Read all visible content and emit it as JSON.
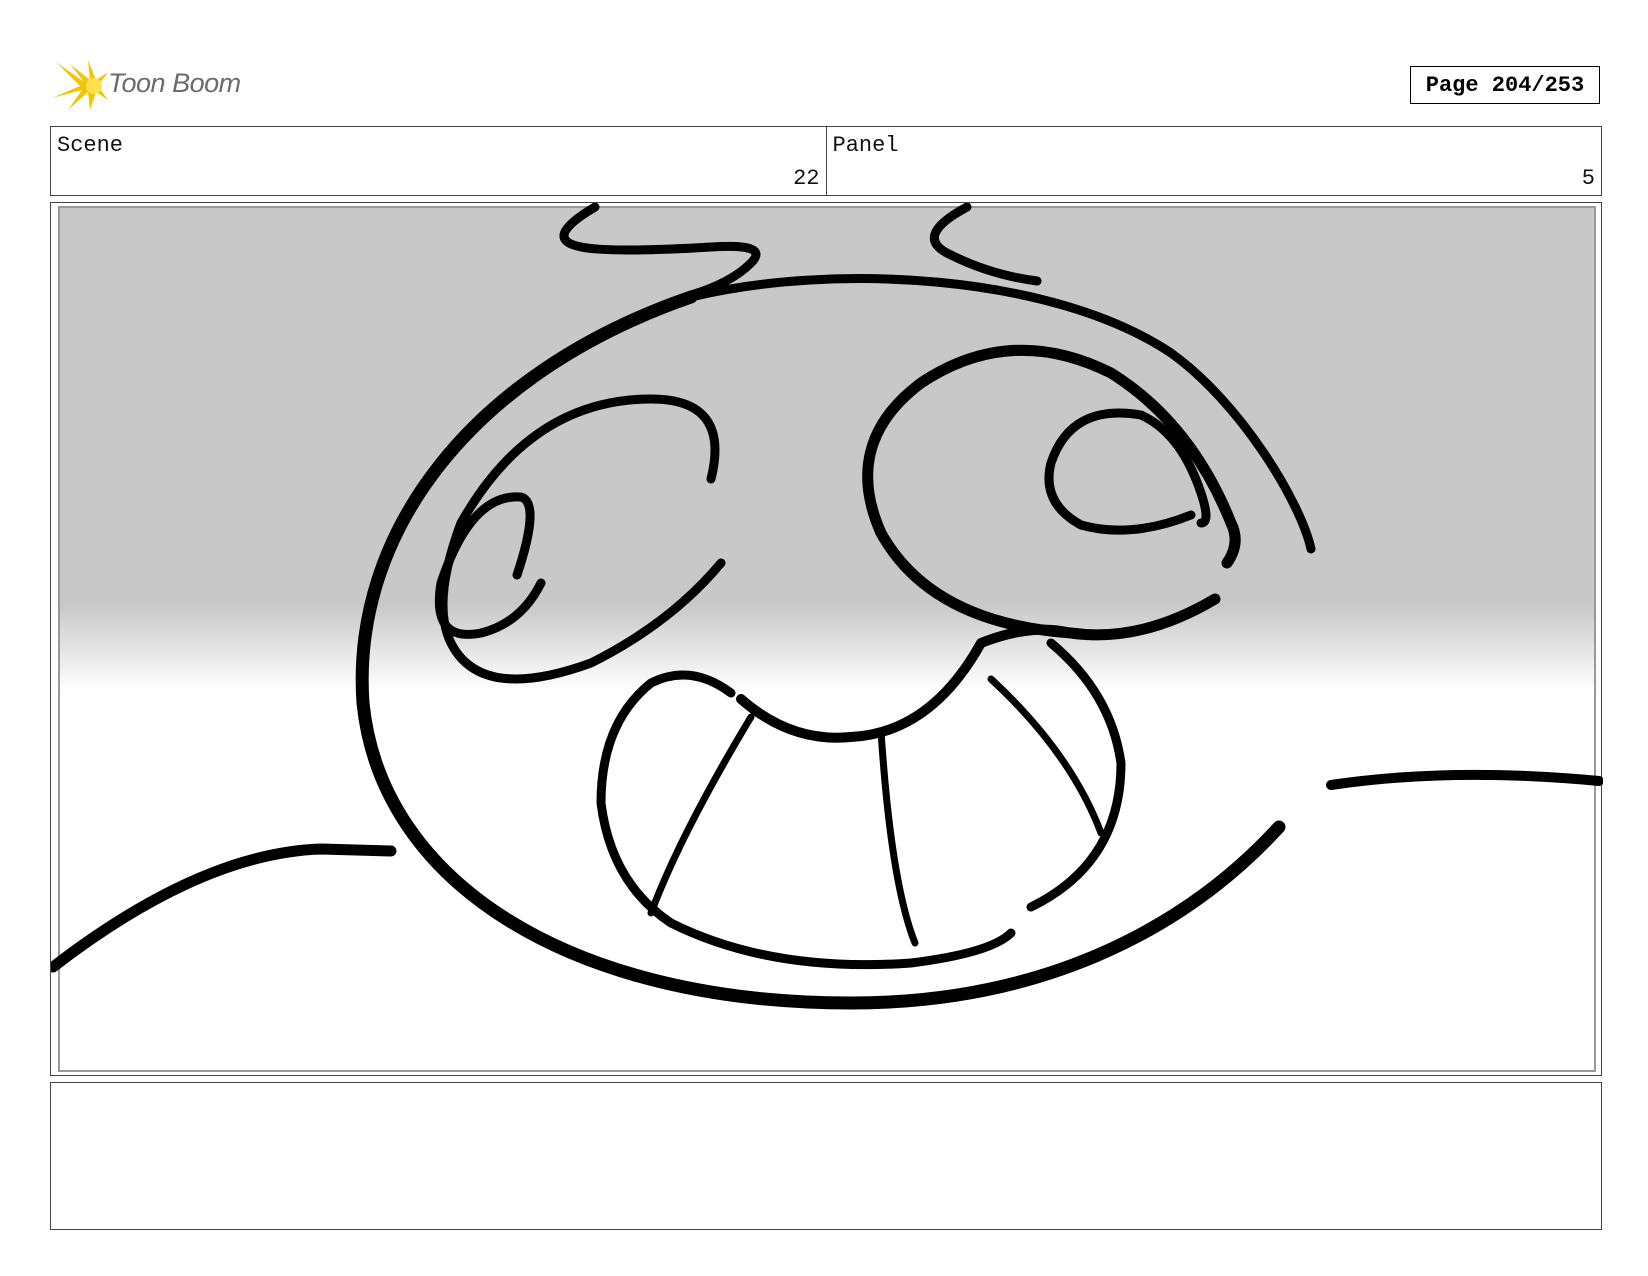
{
  "header": {
    "logo_text": "Toon Boom",
    "page_label": "Page 204/253"
  },
  "scene": {
    "label": "Scene",
    "value": "22"
  },
  "panel": {
    "label": "Panel",
    "value": "5"
  },
  "notes": {
    "text": ""
  },
  "colors": {
    "logo_text": "#6b6b6b",
    "logo_star": "#f5c400",
    "sky_gray": "#c8c8c8",
    "ink": "#000000"
  }
}
